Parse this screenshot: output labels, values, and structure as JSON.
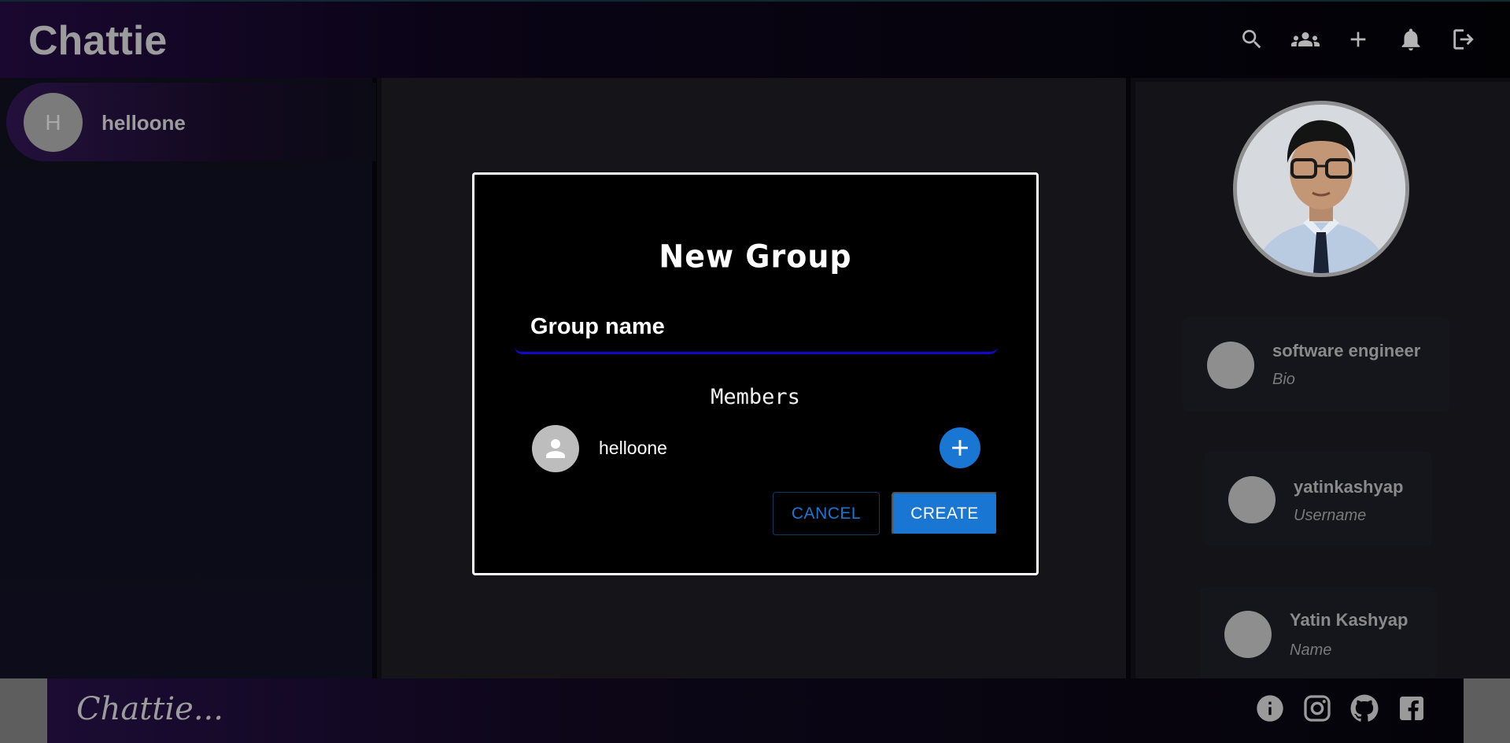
{
  "header": {
    "app_title": "Chattie",
    "icons": [
      "search-icon",
      "group-icon",
      "add-icon",
      "bell-icon",
      "logout-icon"
    ]
  },
  "sidebar": {
    "chats": [
      {
        "avatar_letter": "H",
        "name": "helloone"
      }
    ]
  },
  "profile": {
    "cards": [
      {
        "title": "software engineer",
        "subtitle": "Bio"
      },
      {
        "title": "yatinkashyap",
        "subtitle": "Username"
      },
      {
        "title": "Yatin Kashyap",
        "subtitle": "Name"
      }
    ]
  },
  "footer": {
    "brand": "Chattie...",
    "icons": [
      "info-icon",
      "instagram-icon",
      "github-icon",
      "facebook-icon"
    ]
  },
  "dialog": {
    "title": "New Group",
    "group_name_placeholder": "Group name",
    "members_label": "Members",
    "members": [
      {
        "name": "helloone"
      }
    ],
    "cancel_label": "CANCEL",
    "create_label": "CREATE"
  },
  "colors": {
    "accent": "#1976d2",
    "input_underline": "#1208c8"
  }
}
